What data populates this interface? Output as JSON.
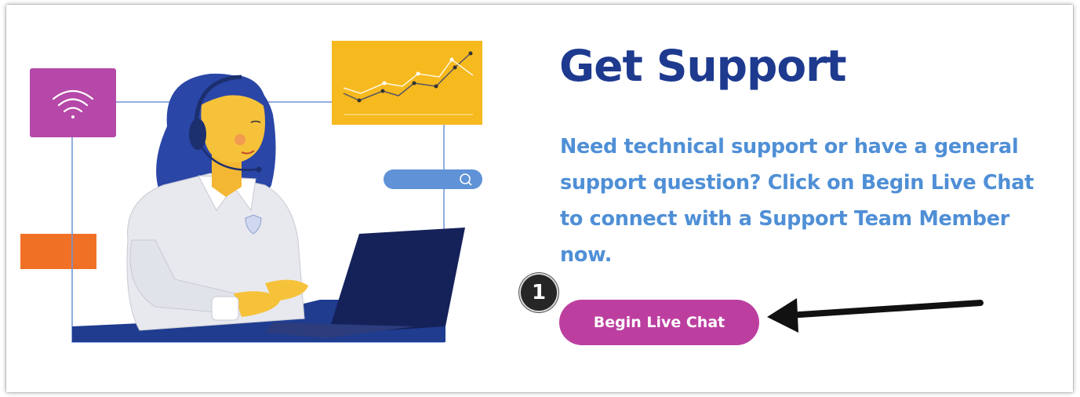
{
  "support": {
    "title": "Get Support",
    "description": "Need technical support or have a general support question? Click on Begin Live Chat to connect with a Support Team Member now.",
    "button_label": "Begin Live Chat"
  },
  "annotation": {
    "step_number": "1"
  },
  "colors": {
    "title": "#1d3a8f",
    "description": "#4f8fd6",
    "button": "#bc3fa0",
    "wifi_tile": "#b548a8",
    "chart_tile": "#f6b91e",
    "orange_block": "#f07126",
    "laptop": "#15225a",
    "hair": "#2a46a6"
  },
  "icons": [
    "wifi-icon",
    "line-chart-icon",
    "search-icon",
    "headset-icon",
    "shield-icon",
    "arrow-left-icon"
  ]
}
